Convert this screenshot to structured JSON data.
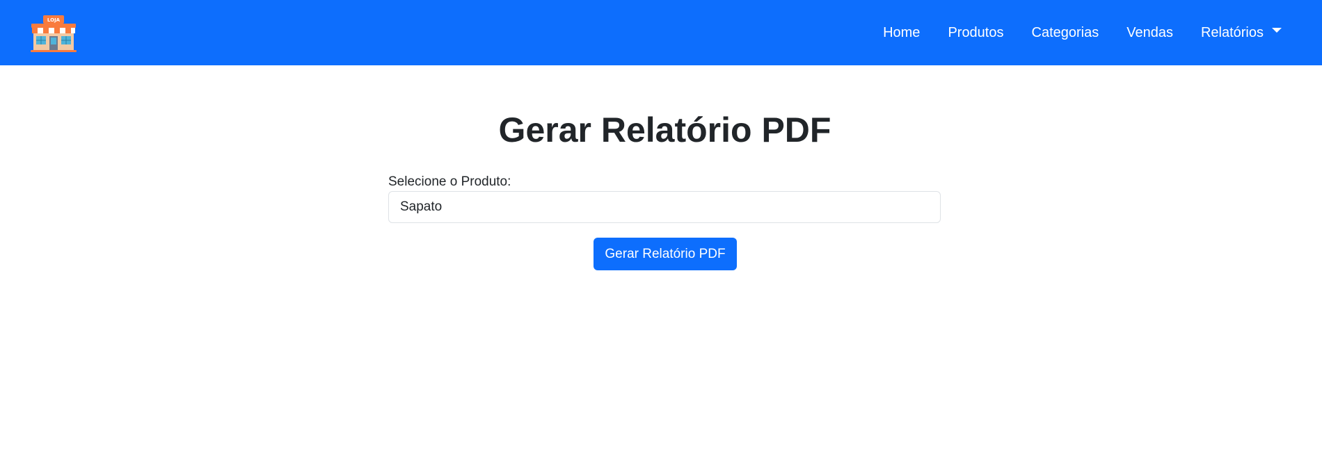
{
  "navbar": {
    "logo": {
      "icon": "store-icon",
      "sign_text": "LOJA"
    },
    "links": {
      "home": "Home",
      "produtos": "Produtos",
      "categorias": "Categorias",
      "vendas": "Vendas",
      "relatorios": "Relatórios"
    },
    "background_color": "#0d6efd"
  },
  "main": {
    "title": "Gerar Relatório PDF",
    "product_label": "Selecione o Produto:",
    "product_selected": "Sapato",
    "submit_label": "Gerar Relatório PDF"
  }
}
